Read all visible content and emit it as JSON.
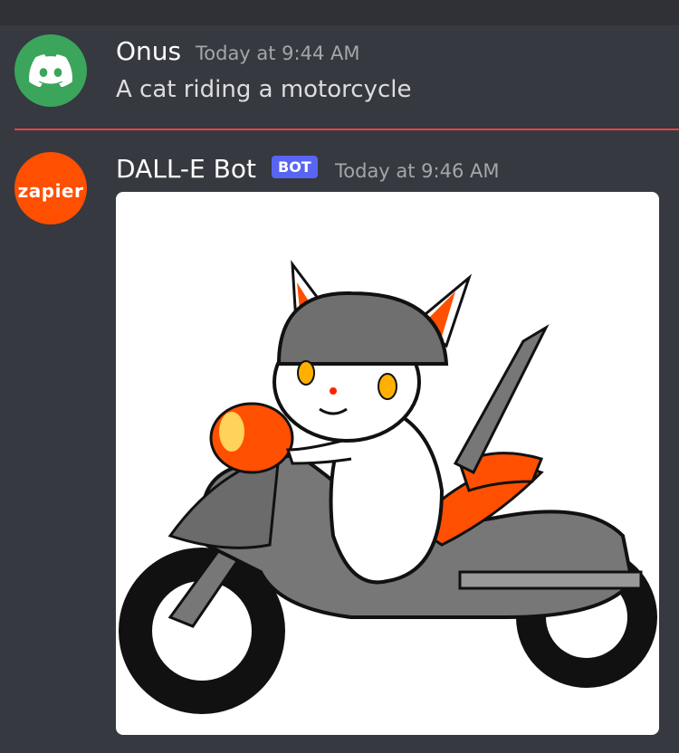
{
  "messages": [
    {
      "username": "Onus",
      "timestamp": "Today at 9:44 AM",
      "content": "A cat riding a motorcycle",
      "avatar_icon": "discord-logo-icon"
    },
    {
      "username": "DALL-E Bot",
      "badge": "BOT",
      "timestamp": "Today at 9:46 AM",
      "avatar_text": "zapier",
      "attachment_icon": "cat-on-motorcycle-image"
    }
  ],
  "colors": {
    "background": "#36393f",
    "divider": "#ed4245",
    "bot_badge": "#5865f2",
    "discord_avatar": "#3ba55c",
    "zapier_avatar": "#ff4f00"
  }
}
